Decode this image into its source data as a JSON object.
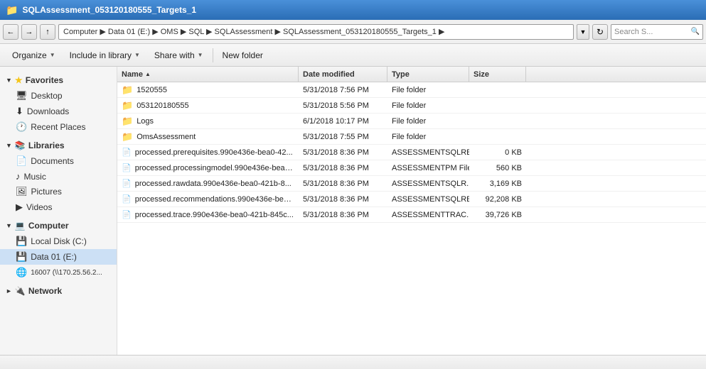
{
  "titleBar": {
    "title": "SQLAssessment_053120180555_Targets_1",
    "icon": "📁"
  },
  "addressBar": {
    "path": "Computer ▶ Data 01 (E:) ▶ OMS ▶ SQL ▶ SQLAssessment ▶ SQLAssessment_053120180555_Targets_1 ▶",
    "searchPlaceholder": "Search S..."
  },
  "toolbar": {
    "organizeLabel": "Organize",
    "includeLibraryLabel": "Include in library",
    "shareWithLabel": "Share with",
    "newFolderLabel": "New folder"
  },
  "sidebar": {
    "favorites": {
      "header": "Favorites",
      "items": [
        {
          "label": "Desktop",
          "icon": "desktop"
        },
        {
          "label": "Downloads",
          "icon": "downloads"
        },
        {
          "label": "Recent Places",
          "icon": "recent"
        }
      ]
    },
    "libraries": {
      "header": "Libraries",
      "items": [
        {
          "label": "Documents",
          "icon": "documents"
        },
        {
          "label": "Music",
          "icon": "music"
        },
        {
          "label": "Pictures",
          "icon": "pictures"
        },
        {
          "label": "Videos",
          "icon": "videos"
        }
      ]
    },
    "computer": {
      "header": "Computer",
      "items": [
        {
          "label": "Local Disk (C:)",
          "icon": "disk"
        },
        {
          "label": "Data 01 (E:)",
          "icon": "disk",
          "selected": true
        },
        {
          "label": "16007 (\\\\170.25.56.2...",
          "icon": "network-drive"
        }
      ]
    },
    "network": {
      "header": "Network",
      "items": []
    }
  },
  "columns": {
    "name": "Name",
    "dateModified": "Date modified",
    "type": "Type",
    "size": "Size"
  },
  "files": [
    {
      "id": 1,
      "name": "1520555",
      "date": "5/31/2018 7:56 PM",
      "type": "File folder",
      "size": "",
      "isFolder": true
    },
    {
      "id": 2,
      "name": "053120180555",
      "date": "5/31/2018 5:56 PM",
      "type": "File folder",
      "size": "",
      "isFolder": true
    },
    {
      "id": 3,
      "name": "Logs",
      "date": "6/1/2018 10:17 PM",
      "type": "File folder",
      "size": "",
      "isFolder": true
    },
    {
      "id": 4,
      "name": "OmsAssessment",
      "date": "5/31/2018 7:55 PM",
      "type": "File folder",
      "size": "",
      "isFolder": true
    },
    {
      "id": 5,
      "name": "processed.prerequisites.990e436e-bea0-42...",
      "date": "5/31/2018 8:36 PM",
      "type": "ASSESSMENTSQLRE...",
      "size": "0 KB",
      "isFolder": false
    },
    {
      "id": 6,
      "name": "processed.processingmodel.990e436e-bea0-...",
      "date": "5/31/2018 8:36 PM",
      "type": "ASSESSMENTPM File",
      "size": "560 KB",
      "isFolder": false
    },
    {
      "id": 7,
      "name": "processed.rawdata.990e436e-bea0-421b-8...",
      "date": "5/31/2018 8:36 PM",
      "type": "ASSESSMENTSQLR...",
      "size": "3,169 KB",
      "isFolder": false
    },
    {
      "id": 8,
      "name": "processed.recommendations.990e436e-bea...",
      "date": "5/31/2018 8:36 PM",
      "type": "ASSESSMENTSQLRE...",
      "size": "92,208 KB",
      "isFolder": false
    },
    {
      "id": 9,
      "name": "processed.trace.990e436e-bea0-421b-845c...",
      "date": "5/31/2018 8:36 PM",
      "type": "ASSESSMENTTRAC...",
      "size": "39,726 KB",
      "isFolder": false
    }
  ],
  "statusBar": {
    "text": ""
  }
}
